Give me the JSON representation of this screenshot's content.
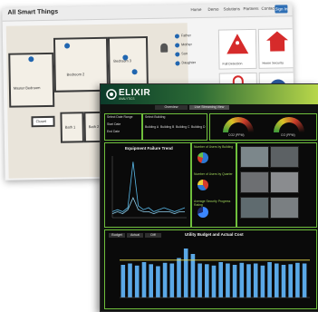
{
  "back_window": {
    "title": "All Smart Things",
    "nav": [
      "Home",
      "Demo",
      "Solutions",
      "Partners",
      "Contact"
    ],
    "signin": "Sign In",
    "rooms": {
      "master_bedroom": "Master Bedroom",
      "bedroom2": "Bedroom 2",
      "bedroom3": "Bedroom 3",
      "bath1": "Bath 1",
      "bath2": "Bath 2",
      "closet": "Closet"
    },
    "legend": [
      "Father",
      "Mother",
      "Son",
      "Daughter"
    ],
    "cards": [
      "Fall Detection",
      "Home Security",
      "Door Lock",
      "Camera"
    ]
  },
  "dashboard": {
    "logo": "ELIXIR",
    "logo_sub": "ANALYTICS",
    "tabs": [
      "Overview",
      "Live Streaming View"
    ],
    "left_box": {
      "title": "Select Date Range",
      "items": [
        "Start Date",
        "End Date"
      ]
    },
    "building_box": {
      "title": "Select Building",
      "items": [
        "Building A",
        "Building B",
        "Building C",
        "Building D"
      ]
    },
    "gauges": [
      "CO2 (PPM)",
      "CO (PPM)"
    ],
    "trend": {
      "title": "Equipment Failure Trend"
    },
    "pies": {
      "t1": "Number of Users by Building",
      "t2": "Number of Users by Quarter",
      "t3": "Average Security Progress Rating"
    },
    "budget": {
      "title": "Utility Budget and Actual Cost",
      "tabs": [
        "Budget",
        "Actual",
        "Diff"
      ]
    }
  },
  "colors": {
    "accent_green": "#6fbf3c",
    "trend_line": "#58b8e8",
    "bar_blue": "#5aa8e6",
    "target_line": "#e7d64a"
  },
  "chart_data": [
    {
      "type": "line",
      "title": "Equipment Failure Trend",
      "series": [
        {
          "values": [
            3,
            4,
            3,
            5,
            28,
            6,
            4,
            5,
            3,
            4,
            5,
            4,
            3,
            4,
            5
          ]
        },
        {
          "values": [
            2,
            3,
            2,
            4,
            10,
            4,
            3,
            3,
            2,
            3,
            3,
            3,
            2,
            3,
            3
          ]
        }
      ]
    },
    {
      "type": "bar",
      "title": "Utility Budget and Actual Cost",
      "values": [
        48,
        50,
        47,
        52,
        49,
        46,
        51,
        50,
        58,
        72,
        64,
        50,
        49,
        47,
        52,
        50,
        48,
        51,
        49,
        50,
        47,
        52,
        50,
        48,
        49,
        51,
        50
      ],
      "target": 55
    }
  ]
}
